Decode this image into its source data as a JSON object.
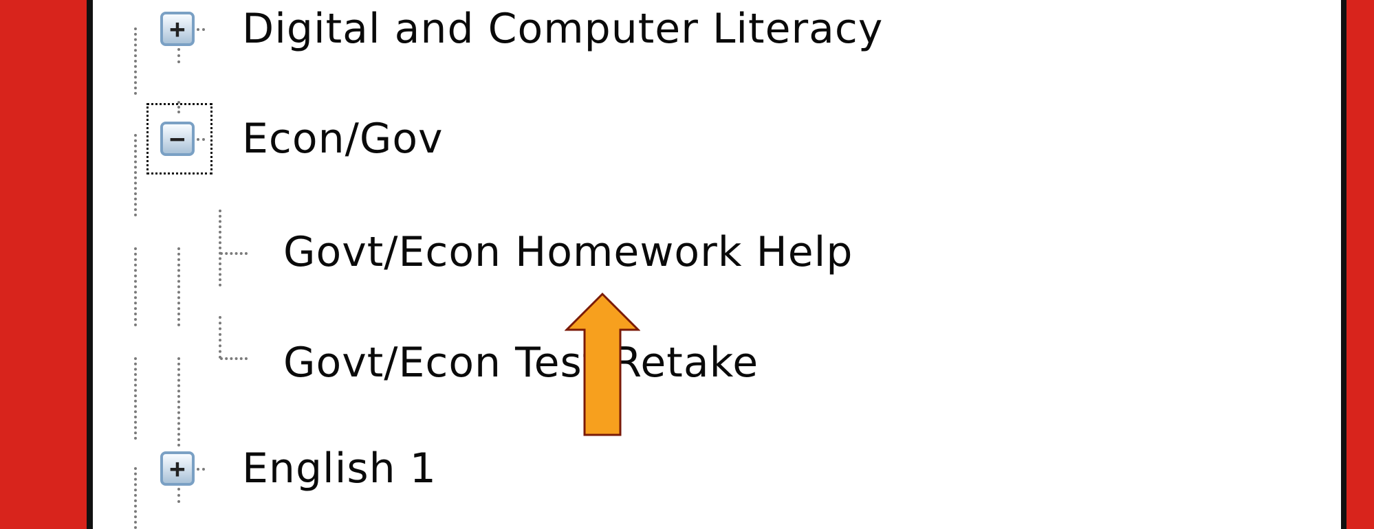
{
  "tree": {
    "items": [
      {
        "label": "Digital and Computer Literacy",
        "toggle": "+",
        "expanded": false,
        "level": 0
      },
      {
        "label": "Econ/Gov",
        "toggle": "−",
        "expanded": true,
        "level": 0,
        "focused": true
      },
      {
        "label": "Govt/Econ Homework Help",
        "level": 1
      },
      {
        "label": "Govt/Econ Test Retake",
        "level": 1
      },
      {
        "label": "English 1",
        "toggle": "+",
        "expanded": false,
        "level": 0
      }
    ]
  },
  "annotation": {
    "arrow_icon": "up-arrow-icon",
    "arrow_fill": "#f7a01e",
    "arrow_stroke": "#7a1a08"
  },
  "colors": {
    "frame": "#d8241c",
    "panel_border": "#111111",
    "tree_lines": "#7a7a7a",
    "toggle_border": "#7aa0c4"
  }
}
